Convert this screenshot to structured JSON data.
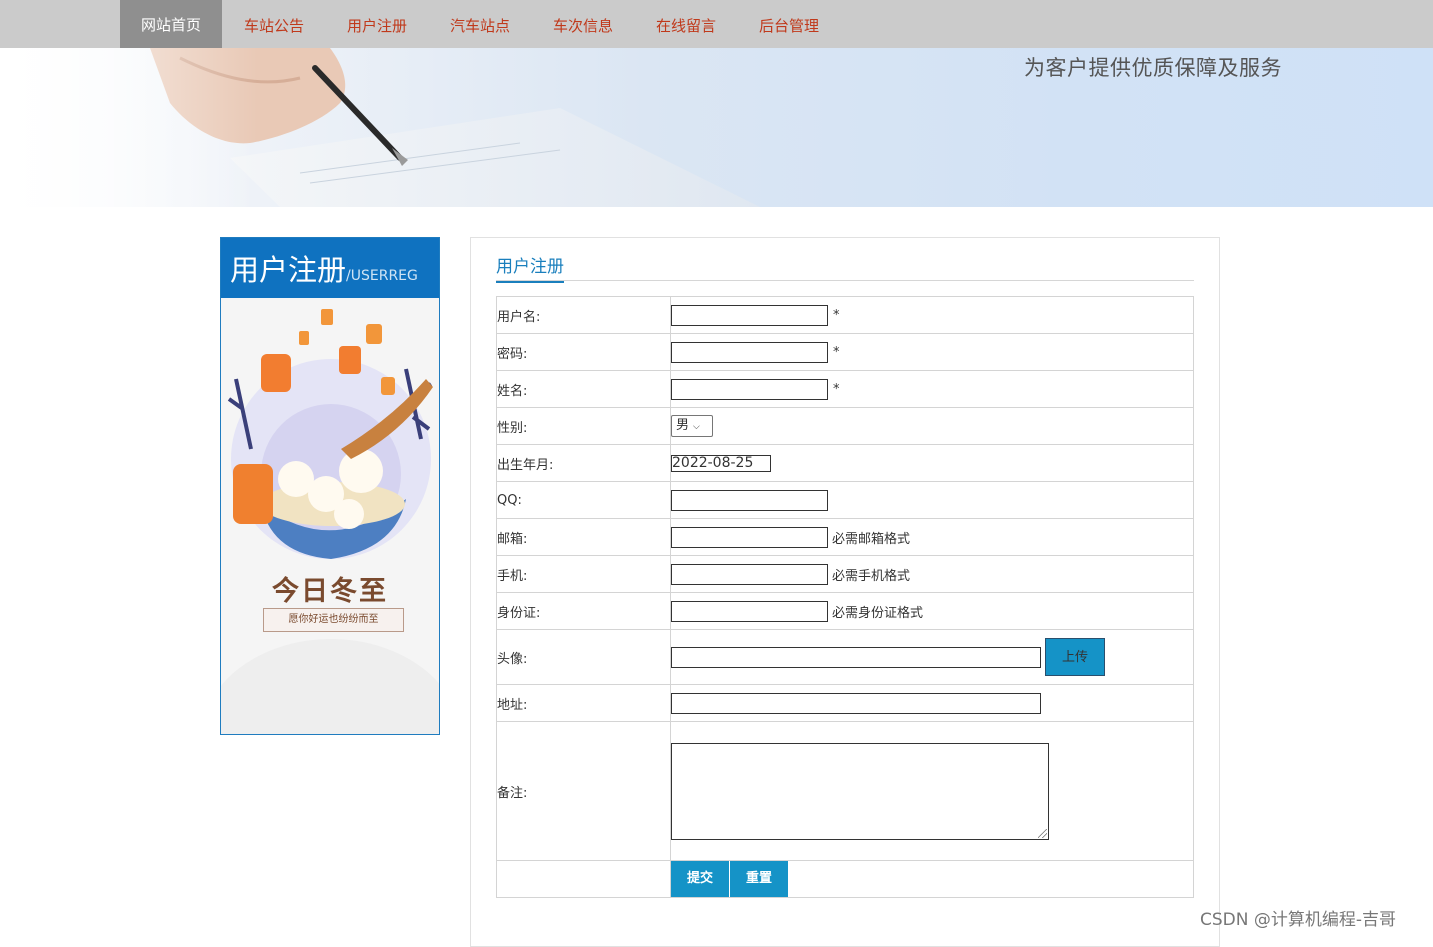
{
  "nav": {
    "items": [
      "网站首页",
      "车站公告",
      "用户注册",
      "汽车站点",
      "车次信息",
      "在线留言",
      "后台管理"
    ],
    "active": "网站首页"
  },
  "banner": {
    "slogan": "为客户提供优质保障及服务"
  },
  "sidebar": {
    "title": "用户注册",
    "subtitle": "/USERREG",
    "poster_title": "今日冬至",
    "poster_caption": "愿你好运也纷纷而至"
  },
  "main": {
    "title": "用户注册",
    "fields": {
      "username": {
        "label": "用户名:",
        "value": "",
        "note": "*"
      },
      "password": {
        "label": "密码:",
        "value": "",
        "note": "*"
      },
      "realname": {
        "label": "姓名:",
        "value": "",
        "note": "*"
      },
      "gender": {
        "label": "性别:",
        "value": "男"
      },
      "birthday": {
        "label": "出生年月:",
        "value": "2022-08-25"
      },
      "qq": {
        "label": "QQ:",
        "value": ""
      },
      "email": {
        "label": "邮箱:",
        "value": "",
        "note": "必需邮箱格式"
      },
      "phone": {
        "label": "手机:",
        "value": "",
        "note": "必需手机格式"
      },
      "idcard": {
        "label": "身份证:",
        "value": "",
        "note": "必需身份证格式"
      },
      "avatar": {
        "label": "头像:",
        "value": "",
        "button": "上传"
      },
      "address": {
        "label": "地址:",
        "value": ""
      },
      "remark": {
        "label": "备注:",
        "value": ""
      }
    },
    "submit_label": "提交",
    "reset_label": "重置"
  },
  "watermark": "CSDN @计算机编程-吉哥",
  "colors": {
    "accent": "#1593c7",
    "nav_text": "#c0391b",
    "header_blue": "#0f72c0"
  }
}
